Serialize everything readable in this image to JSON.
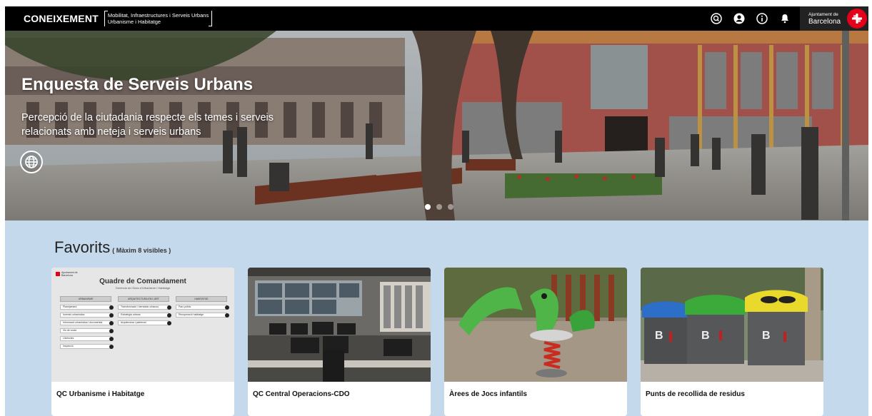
{
  "header": {
    "brand": "CONEIXEMENT",
    "subtitle_line1": "Mobilitat, Infraestructures i Serveis Urbans",
    "subtitle_line2": "Urbanisme i Habitatge",
    "icons": [
      "search-icon",
      "user-icon",
      "info-icon",
      "bell-icon"
    ],
    "ajuntament_small": "Ajuntament de",
    "ajuntament_name": "Barcelona"
  },
  "hero": {
    "title": "Enquesta de Serveis Urbans",
    "description": "Percepció de la ciutadania respecte els temes i serveis relacionats amb neteja i serveis urbans",
    "slides": 3,
    "active_slide": 1
  },
  "favorites": {
    "title": "Favorits",
    "note": "( Màxim 8 visibles )",
    "cards": [
      {
        "caption": "QC Urbanisme i Habitatge"
      },
      {
        "caption": "QC Central Operacions-CDO"
      },
      {
        "caption": "Àrees de Jocs infantils"
      },
      {
        "caption": "Punts de recollida de residus"
      }
    ]
  },
  "dashboard_thumb": {
    "org": "Ajuntament de Barcelona",
    "title": "Quadre de Comandament",
    "subtitle": "Gerència de l'Àrea d'Urbanisme i Habitatge",
    "columns": [
      {
        "head": "URBANISME",
        "rows": [
          "Planejament",
          "Inversió urbanística",
          "Informació urbanística i documental",
          "Vis de costa",
          "Llicències",
          "Inspecció"
        ]
      },
      {
        "head": "ARQUITECTURA EN L'ART",
        "rows": [
          "Transformació i bienestar urbanos",
          "Estratègia urbana",
          "Arquitectura i patrimoni"
        ]
      },
      {
        "head": "HABITATGE",
        "rows": [
          "Parc públic",
          "Recuperació habitatge"
        ]
      }
    ]
  },
  "colors": {
    "topbar": "#000000",
    "section_bg": "#c5d9ec",
    "brand_red": "#e2001a"
  }
}
